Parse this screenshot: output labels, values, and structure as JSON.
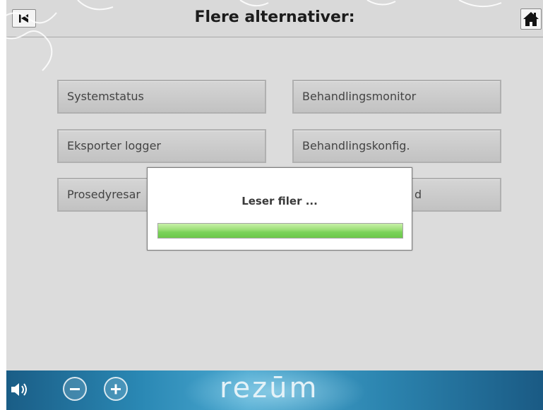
{
  "header": {
    "title": "Flere alternativer:",
    "back_icon": "skip-back-icon",
    "home_icon": "home-icon"
  },
  "options": {
    "system_status": "Systemstatus",
    "treatment_monitor": "Behandlingsmonitor",
    "export_logs": "Eksporter logger",
    "treatment_config": "Behandlingskonfig.",
    "procedure_partial": "Prosedyresar",
    "right_partial": "d"
  },
  "modal": {
    "title": "Leser filer ...",
    "progress_fraction": 1.0
  },
  "footer": {
    "logo": "rezūm",
    "speaker_icon": "speaker-icon",
    "minus_icon": "minus-icon",
    "plus_icon": "plus-icon"
  },
  "colors": {
    "background": "#dcdcdc",
    "progress": "#7bd25a",
    "footer": "#2a88b4"
  }
}
